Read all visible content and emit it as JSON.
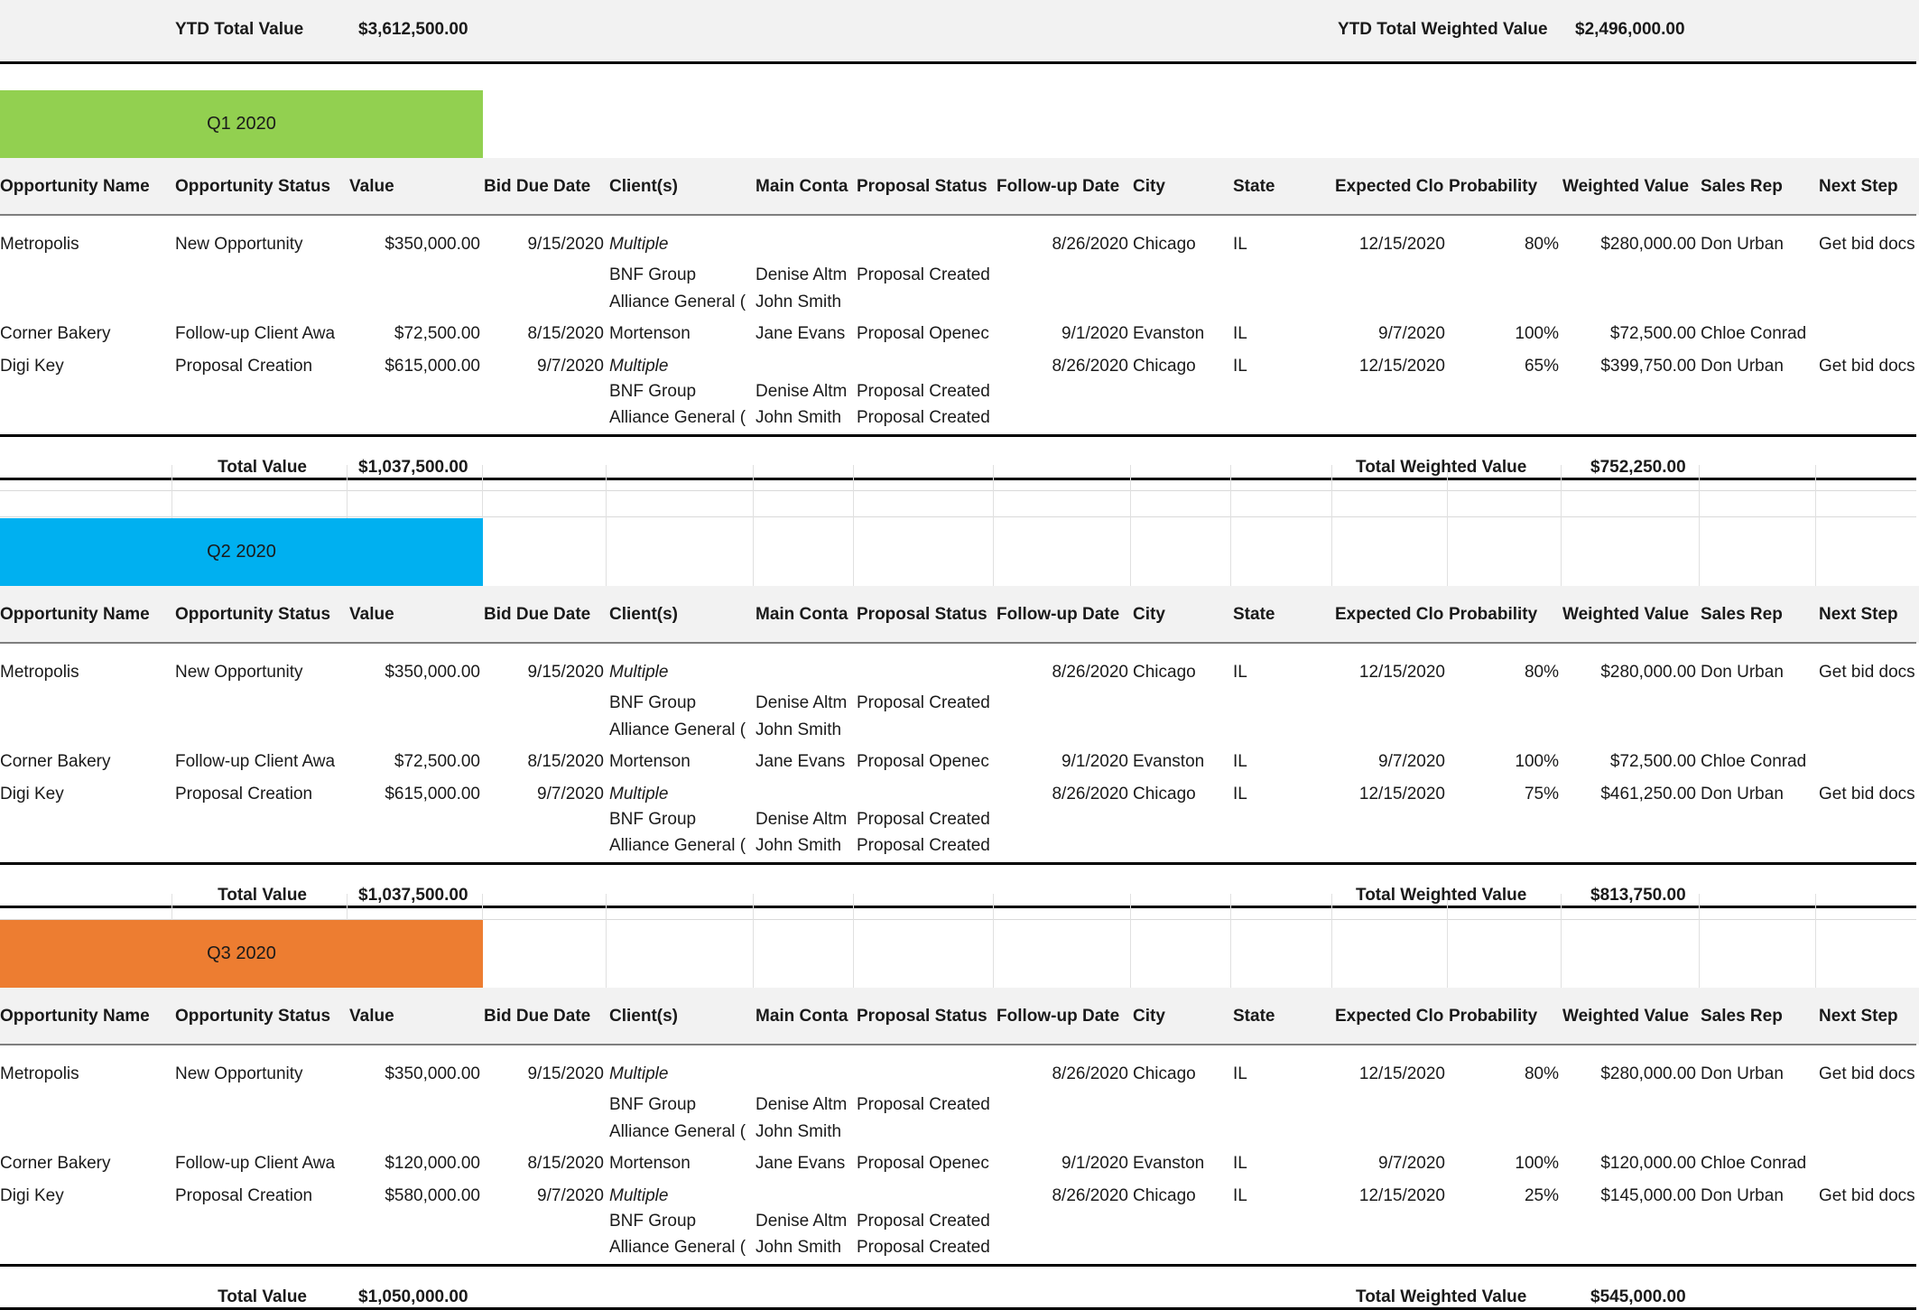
{
  "ytd": {
    "total_label": "YTD Total Value",
    "total_value": "$3,612,500.00",
    "weighted_label": "YTD Total Weighted Value",
    "weighted_value": "$2,496,000.00"
  },
  "columns": [
    "Opportunity Name",
    "Opportunity Status",
    "Value",
    "Bid Due Date",
    "Client(s)",
    "Main Conta",
    "Proposal Status",
    "Follow-up Date",
    "City",
    "State",
    "Expected Clo:",
    "Probability",
    "Weighted Value",
    "Sales Rep",
    "Next Step"
  ],
  "colors": {
    "q1": "#92d050",
    "q2": "#00b0f0",
    "q3": "#ed7d31",
    "header_bg": "#f2f2f2"
  },
  "quarters": [
    {
      "label": "Q1 2020",
      "total_label": "Total Value",
      "total_value": "$1,037,500.00",
      "weighted_label": "Total Weighted Value",
      "weighted_value": "$752,250.00",
      "rows": [
        {
          "name": "Metropolis",
          "status": "New Opportunity",
          "value": "$350,000.00",
          "bid_due": "9/15/2020",
          "client": "Multiple",
          "follow_up": "8/26/2020",
          "city": "Chicago",
          "state": "IL",
          "expected_close": "12/15/2020",
          "probability": "80%",
          "weighted": "$280,000.00",
          "rep": "Don Urban",
          "next_step": "Get bid docs",
          "sub": [
            {
              "client": "BNF Group",
              "contact": "Denise Altm",
              "proposal": "Proposal Created"
            },
            {
              "client": "Alliance General (",
              "contact": "John Smith",
              "proposal": ""
            }
          ]
        },
        {
          "name": "Corner Bakery",
          "status": "Follow-up Client Awa",
          "value": "$72,500.00",
          "bid_due": "8/15/2020",
          "client": "Mortenson",
          "contact": "Jane Evans",
          "proposal": "Proposal Openec",
          "follow_up": "9/1/2020",
          "city": "Evanston",
          "state": "IL",
          "expected_close": "9/7/2020",
          "probability": "100%",
          "weighted": "$72,500.00",
          "rep": "Chloe Conrad",
          "next_step": ""
        },
        {
          "name": "Digi Key",
          "status": "Proposal Creation",
          "value": "$615,000.00",
          "bid_due": "9/7/2020",
          "client": "Multiple",
          "follow_up": "8/26/2020",
          "city": "Chicago",
          "state": "IL",
          "expected_close": "12/15/2020",
          "probability": "65%",
          "weighted": "$399,750.00",
          "rep": "Don Urban",
          "next_step": "Get bid docs",
          "sub": [
            {
              "client": "BNF Group",
              "contact": "Denise Altm",
              "proposal": "Proposal Created"
            },
            {
              "client": "Alliance General (",
              "contact": "John Smith",
              "proposal": "Proposal Created"
            }
          ]
        }
      ]
    },
    {
      "label": "Q2 2020",
      "total_label": "Total Value",
      "total_value": "$1,037,500.00",
      "weighted_label": "Total Weighted Value",
      "weighted_value": "$813,750.00",
      "rows": [
        {
          "name": "Metropolis",
          "status": "New Opportunity",
          "value": "$350,000.00",
          "bid_due": "9/15/2020",
          "client": "Multiple",
          "follow_up": "8/26/2020",
          "city": "Chicago",
          "state": "IL",
          "expected_close": "12/15/2020",
          "probability": "80%",
          "weighted": "$280,000.00",
          "rep": "Don Urban",
          "next_step": "Get bid docs",
          "sub": [
            {
              "client": "BNF Group",
              "contact": "Denise Altm",
              "proposal": "Proposal Created"
            },
            {
              "client": "Alliance General (",
              "contact": "John Smith",
              "proposal": ""
            }
          ]
        },
        {
          "name": "Corner Bakery",
          "status": "Follow-up Client Awa",
          "value": "$72,500.00",
          "bid_due": "8/15/2020",
          "client": "Mortenson",
          "contact": "Jane Evans",
          "proposal": "Proposal Openec",
          "follow_up": "9/1/2020",
          "city": "Evanston",
          "state": "IL",
          "expected_close": "9/7/2020",
          "probability": "100%",
          "weighted": "$72,500.00",
          "rep": "Chloe Conrad",
          "next_step": ""
        },
        {
          "name": "Digi Key",
          "status": "Proposal Creation",
          "value": "$615,000.00",
          "bid_due": "9/7/2020",
          "client": "Multiple",
          "follow_up": "8/26/2020",
          "city": "Chicago",
          "state": "IL",
          "expected_close": "12/15/2020",
          "probability": "75%",
          "weighted": "$461,250.00",
          "rep": "Don Urban",
          "next_step": "Get bid docs",
          "sub": [
            {
              "client": "BNF Group",
              "contact": "Denise Altm",
              "proposal": "Proposal Created"
            },
            {
              "client": "Alliance General (",
              "contact": "John Smith",
              "proposal": "Proposal Created"
            }
          ]
        }
      ]
    },
    {
      "label": "Q3 2020",
      "total_label": "Total Value",
      "total_value": "$1,050,000.00",
      "weighted_label": "Total Weighted Value",
      "weighted_value": "$545,000.00",
      "rows": [
        {
          "name": "Metropolis",
          "status": "New Opportunity",
          "value": "$350,000.00",
          "bid_due": "9/15/2020",
          "client": "Multiple",
          "follow_up": "8/26/2020",
          "city": "Chicago",
          "state": "IL",
          "expected_close": "12/15/2020",
          "probability": "80%",
          "weighted": "$280,000.00",
          "rep": "Don Urban",
          "next_step": "Get bid docs",
          "sub": [
            {
              "client": "BNF Group",
              "contact": "Denise Altm",
              "proposal": "Proposal Created"
            },
            {
              "client": "Alliance General (",
              "contact": "John Smith",
              "proposal": ""
            }
          ]
        },
        {
          "name": "Corner Bakery",
          "status": "Follow-up Client Awa",
          "value": "$120,000.00",
          "bid_due": "8/15/2020",
          "client": "Mortenson",
          "contact": "Jane Evans",
          "proposal": "Proposal Openec",
          "follow_up": "9/1/2020",
          "city": "Evanston",
          "state": "IL",
          "expected_close": "9/7/2020",
          "probability": "100%",
          "weighted": "$120,000.00",
          "rep": "Chloe Conrad",
          "next_step": ""
        },
        {
          "name": "Digi Key",
          "status": "Proposal Creation",
          "value": "$580,000.00",
          "bid_due": "9/7/2020",
          "client": "Multiple",
          "follow_up": "8/26/2020",
          "city": "Chicago",
          "state": "IL",
          "expected_close": "12/15/2020",
          "probability": "25%",
          "weighted": "$145,000.00",
          "rep": "Don Urban",
          "next_step": "Get bid docs",
          "sub": [
            {
              "client": "BNF Group",
              "contact": "Denise Altm",
              "proposal": "Proposal Created"
            },
            {
              "client": "Alliance General (",
              "contact": "John Smith",
              "proposal": "Proposal Created"
            }
          ]
        }
      ]
    }
  ]
}
